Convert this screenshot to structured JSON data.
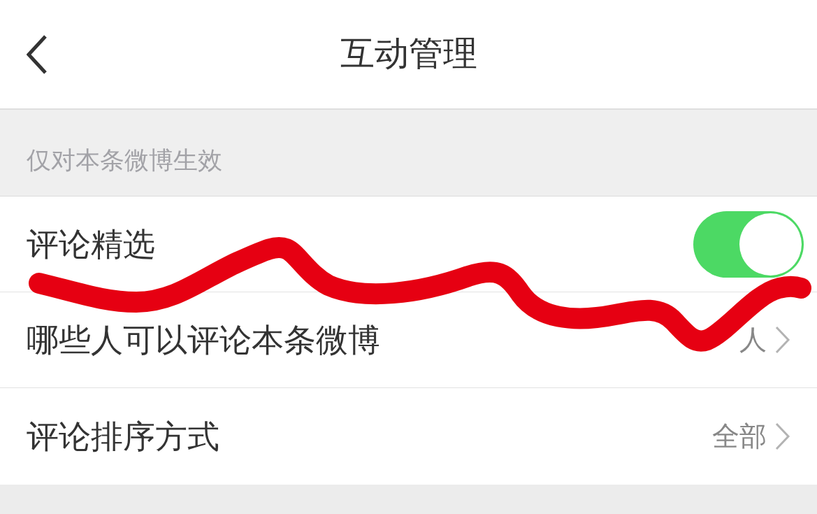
{
  "nav": {
    "title": "互动管理"
  },
  "section": {
    "header": "仅对本条微博生效"
  },
  "rows": [
    {
      "kind": "toggle",
      "label": "评论精选",
      "on": true
    },
    {
      "kind": "link",
      "label": "哪些人可以评论本条微博",
      "value": "人"
    },
    {
      "kind": "link",
      "label": "评论排序方式",
      "value": "全部"
    }
  ]
}
